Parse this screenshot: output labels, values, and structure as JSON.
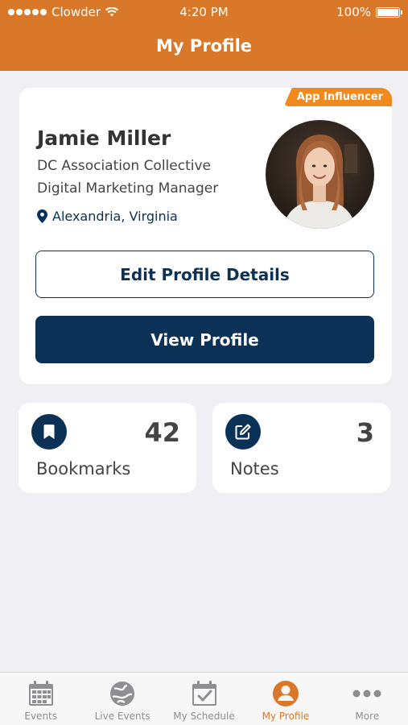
{
  "status_bar": {
    "carrier": "Clowder",
    "time": "4:20 PM",
    "battery": "100%",
    "battery_level": 1.0
  },
  "header": {
    "title": "My Profile"
  },
  "profile": {
    "badge": "App Influencer",
    "name": "Jamie Miller",
    "organization": "DC Association Collective",
    "role": "Digital Marketing Manager",
    "location": "Alexandria, Virginia",
    "edit_button": "Edit Profile Details",
    "view_button": "View Profile"
  },
  "stats": [
    {
      "label": "Bookmarks",
      "count": "42",
      "icon": "bookmark-icon"
    },
    {
      "label": "Notes",
      "count": "3",
      "icon": "edit-note-icon"
    }
  ],
  "tabs": [
    {
      "label": "Events",
      "icon": "calendar-icon",
      "active": false
    },
    {
      "label": "Live Events",
      "icon": "globe-icon",
      "active": false
    },
    {
      "label": "My Schedule",
      "icon": "calendar-check-icon",
      "active": false
    },
    {
      "label": "My Profile",
      "icon": "user-circle-icon",
      "active": true
    },
    {
      "label": "More",
      "icon": "more-dots-icon",
      "active": false
    }
  ],
  "colors": {
    "brand_orange": "#D97829",
    "badge_orange": "#F08A1F",
    "navy": "#0B3256",
    "background": "#EFEFF4",
    "tab_inactive": "#8E8E93"
  }
}
